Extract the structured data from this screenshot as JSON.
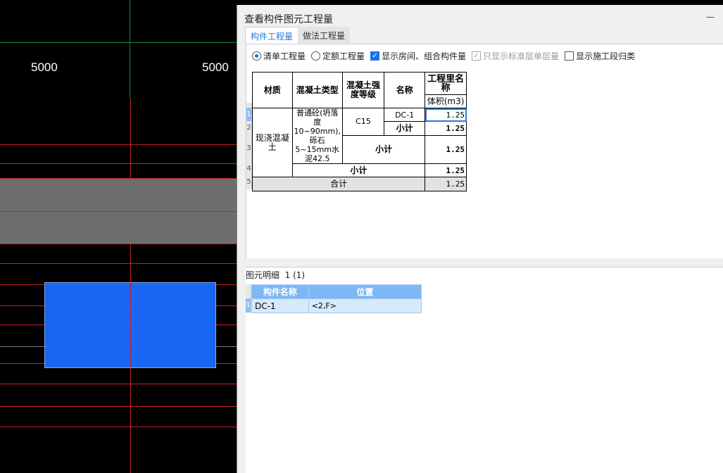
{
  "cad": {
    "dimensions": [
      "5000",
      "5000"
    ],
    "colors": {
      "background": "#000000",
      "element": "#1a6cff",
      "band": "#6e6e6e",
      "axis": "#c8202a"
    }
  },
  "dialog": {
    "title": "查看构件图元工程量",
    "minimize": "—",
    "tabs": [
      {
        "label": "构件工程量",
        "active": true
      },
      {
        "label": "做法工程量",
        "active": false
      }
    ],
    "options": [
      {
        "label": "清单工程量",
        "type": "radio",
        "checked": true
      },
      {
        "label": "定额工程量",
        "type": "radio",
        "checked": false
      },
      {
        "label": "显示房间、组合构件量",
        "type": "checkbox",
        "checked": true
      },
      {
        "label": "只显示标准层单层量",
        "type": "checkbox",
        "checked": true,
        "disabled": true
      },
      {
        "label": "显示施工段归类",
        "type": "checkbox",
        "checked": false
      }
    ],
    "quantity_table": {
      "headers": [
        "材质",
        "混凝土类型",
        "混凝土强度等级",
        "名称",
        "工程里名称"
      ],
      "unit": "体积(m3)",
      "row_numbers": [
        "1",
        "2",
        "3",
        "4",
        "5"
      ],
      "material": "现浇混凝土",
      "concrete_type": "普通砼(坍落度10~90mm),砾石5~15mm水泥42.5",
      "grade": "C15",
      "rows": [
        {
          "name": "DC-1",
          "value": "1.25"
        },
        {
          "name": "小计",
          "value": "1.25"
        },
        {
          "name": "小计",
          "value": "1.25"
        },
        {
          "name": "小计",
          "value": "1.25"
        },
        {
          "name": "合计",
          "value": "1.25"
        }
      ]
    },
    "detail": {
      "label": "图元明细",
      "count": "1 (1)",
      "headers": [
        "构件名称",
        "位置"
      ],
      "rows": [
        {
          "num": "1",
          "name": "DC-1",
          "position": "<2,F>"
        }
      ]
    }
  }
}
